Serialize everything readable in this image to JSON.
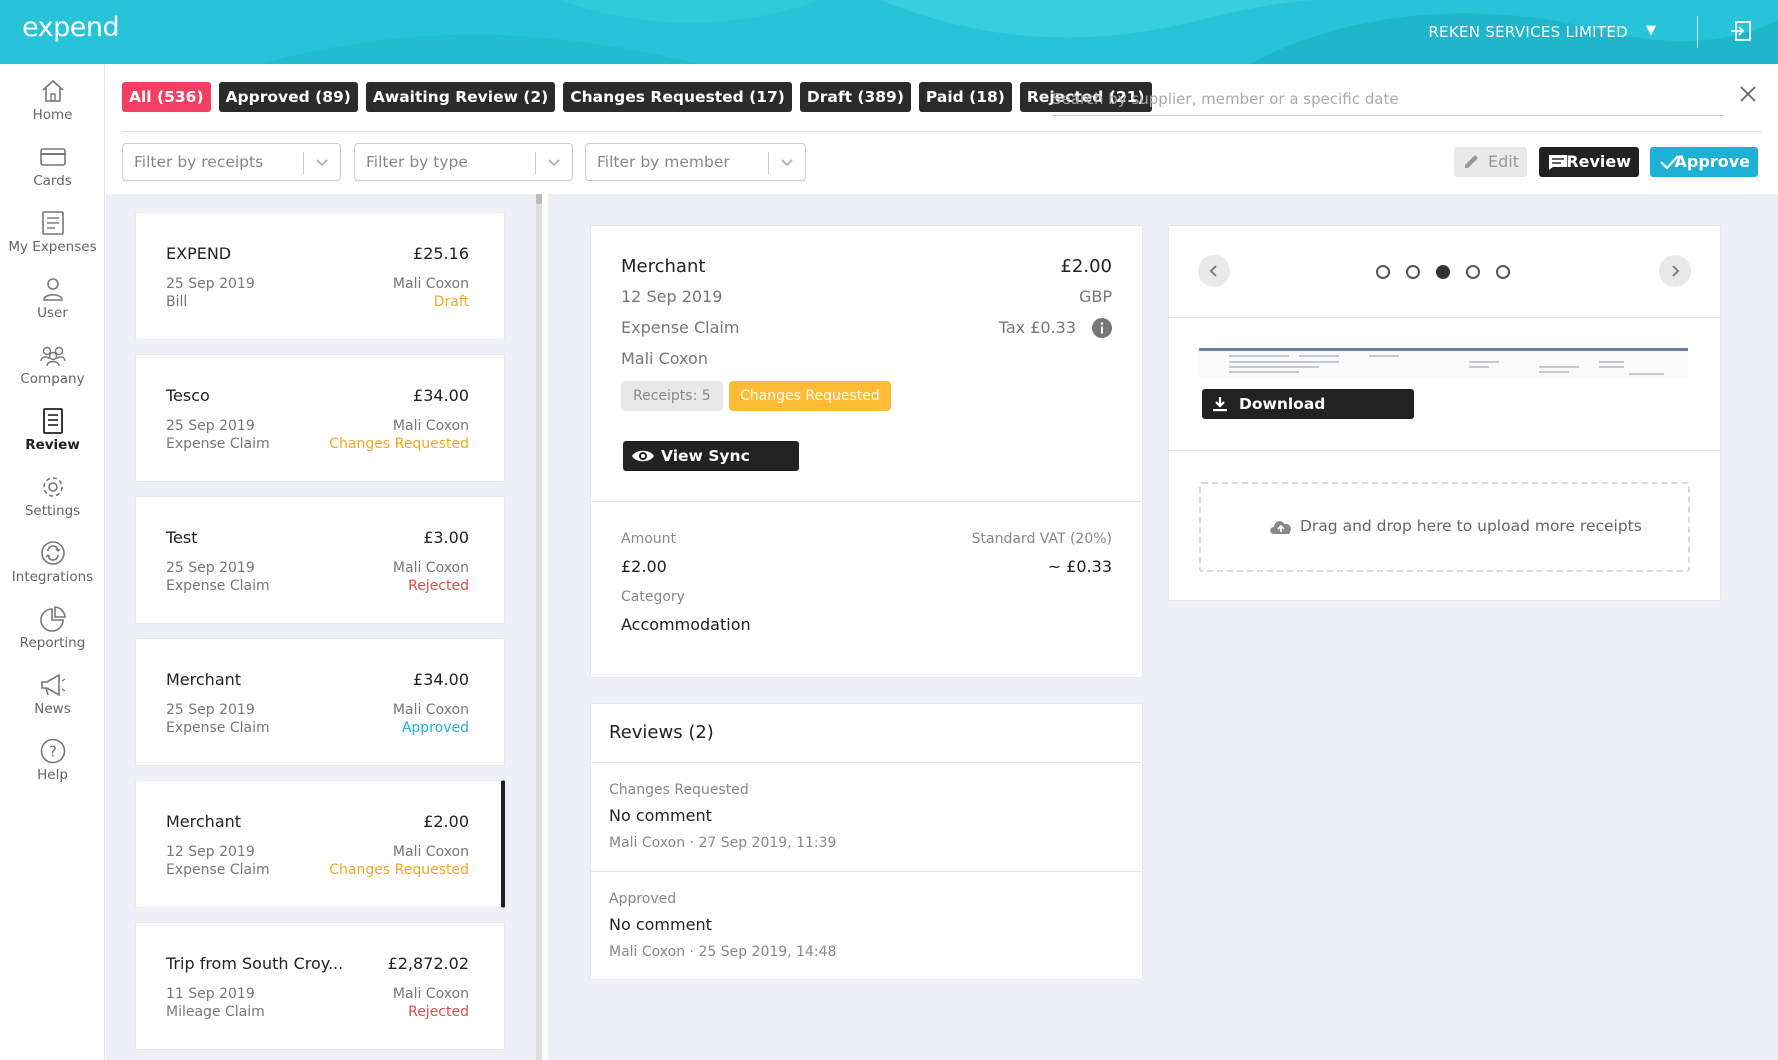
{
  "app": {
    "logo": "expend",
    "company": "REKEN SERVICES LIMITED"
  },
  "sidebar": {
    "items": [
      {
        "label": "Home",
        "icon": "home-icon"
      },
      {
        "label": "Cards",
        "icon": "card-icon"
      },
      {
        "label": "My Expenses",
        "icon": "expenses-icon"
      },
      {
        "label": "User",
        "icon": "user-icon"
      },
      {
        "label": "Company",
        "icon": "company-icon"
      },
      {
        "label": "Review",
        "icon": "review-icon",
        "active": true
      },
      {
        "label": "Settings",
        "icon": "gear-icon"
      },
      {
        "label": "Integrations",
        "icon": "sync-icon"
      },
      {
        "label": "Reporting",
        "icon": "pie-chart-icon"
      },
      {
        "label": "News",
        "icon": "megaphone-icon"
      },
      {
        "label": "Help",
        "icon": "help-icon"
      }
    ]
  },
  "tabs": [
    {
      "label": "All (536)",
      "active": true
    },
    {
      "label": "Approved (89)"
    },
    {
      "label": "Awaiting Review (2)"
    },
    {
      "label": "Changes Requested (17)"
    },
    {
      "label": "Draft (389)"
    },
    {
      "label": "Paid (18)"
    },
    {
      "label": "Rejected (21)"
    }
  ],
  "search": {
    "placeholder": "Search by supplier, member or a specific date",
    "value": ""
  },
  "filters": {
    "receipts": "Filter by receipts",
    "type": "Filter by type",
    "member": "Filter by member"
  },
  "actions": {
    "edit": "Edit",
    "review": "Review",
    "approve": "Approve"
  },
  "expenses": [
    {
      "name": "EXPEND",
      "amount": "£25.16",
      "date": "25 Sep 2019",
      "type": "Bill",
      "member": "Mali Coxon",
      "status": "Draft",
      "status_key": "draft"
    },
    {
      "name": "Tesco",
      "amount": "£34.00",
      "date": "25 Sep 2019",
      "type": "Expense Claim",
      "member": "Mali Coxon",
      "status": "Changes Requested",
      "status_key": "changes"
    },
    {
      "name": "Test",
      "amount": "£3.00",
      "date": "25 Sep 2019",
      "type": "Expense Claim",
      "member": "Mali Coxon",
      "status": "Rejected",
      "status_key": "rejected"
    },
    {
      "name": "Merchant",
      "amount": "£34.00",
      "date": "25 Sep 2019",
      "type": "Expense Claim",
      "member": "Mali Coxon",
      "status": "Approved",
      "status_key": "approved"
    },
    {
      "name": "Merchant",
      "amount": "£2.00",
      "date": "12 Sep 2019",
      "type": "Expense Claim",
      "member": "Mali Coxon",
      "status": "Changes Requested",
      "status_key": "changes",
      "selected": true
    },
    {
      "name": "Trip from South Croy...",
      "amount": "£2,872.02",
      "date": "11 Sep 2019",
      "type": "Mileage Claim",
      "member": "Mali Coxon",
      "status": "Rejected",
      "status_key": "rejected"
    }
  ],
  "detail": {
    "merchant": "Merchant",
    "amount": "£2.00",
    "date": "12 Sep 2019",
    "currency": "GBP",
    "type": "Expense Claim",
    "tax": "Tax £0.33",
    "member": "Mali Coxon",
    "receipts": "Receipts: 5",
    "status": "Changes Requested",
    "sync_button": "View Sync Status",
    "amount_label": "Amount",
    "amount_value": "£2.00",
    "vat_label": "Standard VAT (20%)",
    "vat_value": "~ £0.33",
    "category_label": "Category",
    "category_value": "Accommodation"
  },
  "reviews": {
    "title": "Reviews (2)",
    "items": [
      {
        "status": "Changes Requested",
        "comment": "No comment",
        "meta": "Mali Coxon · 27 Sep 2019, 11:39"
      },
      {
        "status": "Approved",
        "comment": "No comment",
        "meta": "Mali Coxon · 25 Sep 2019, 14:48"
      }
    ]
  },
  "attachment": {
    "current_page": 3,
    "total_pages": 5,
    "download": "Download attachment",
    "dropzone": "Drag and drop here to upload more receipts"
  }
}
